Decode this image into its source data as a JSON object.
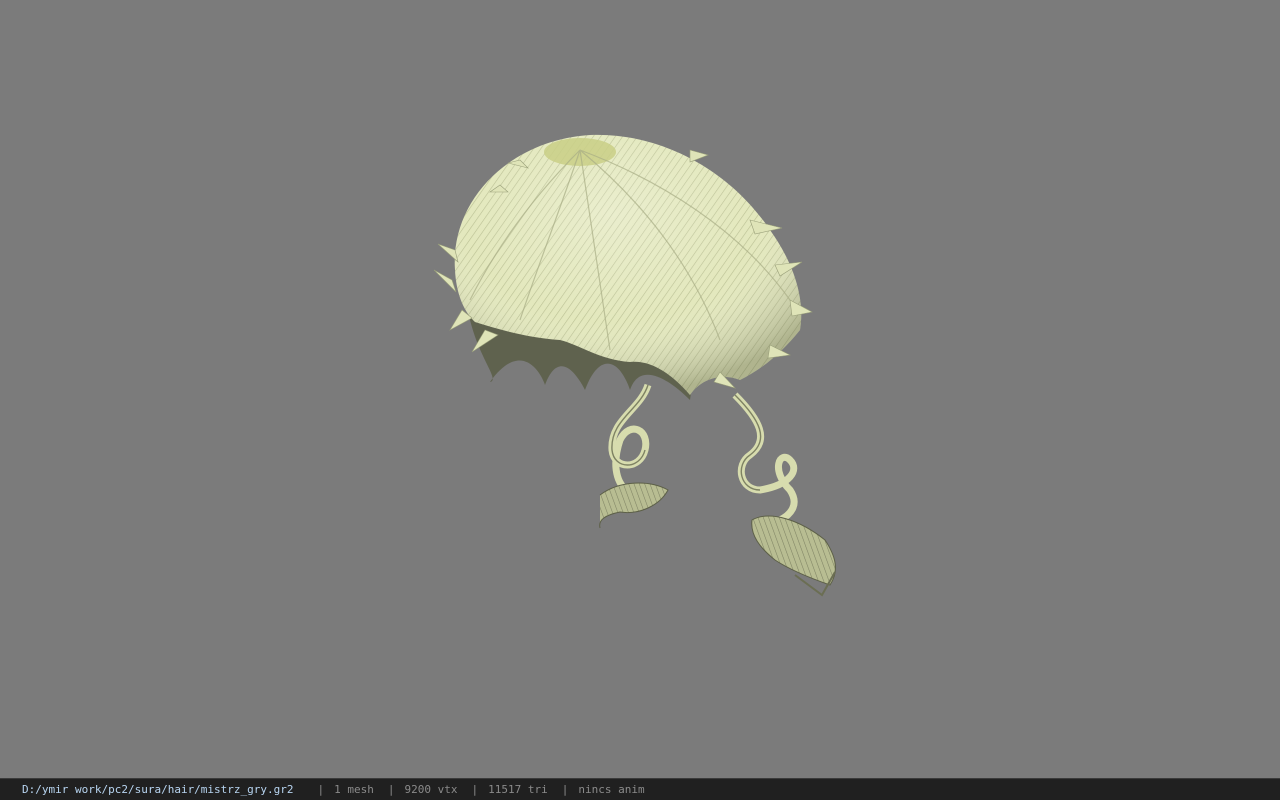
{
  "viewer": {
    "background_color": "#7b7b7b",
    "hair_base_color": "#e6ebc2",
    "hair_shadow_color": "#6f7358",
    "model_name": "hair-model"
  },
  "statusbar": {
    "file_path": "D:/ymir work/pc2/sura/hair/mistrz_gry.gr2",
    "separator": "|",
    "mesh_count": "1 mesh",
    "vertex_count": "9200 vtx",
    "triangle_count": "11517 tri",
    "anim_status": "nincs anim"
  }
}
